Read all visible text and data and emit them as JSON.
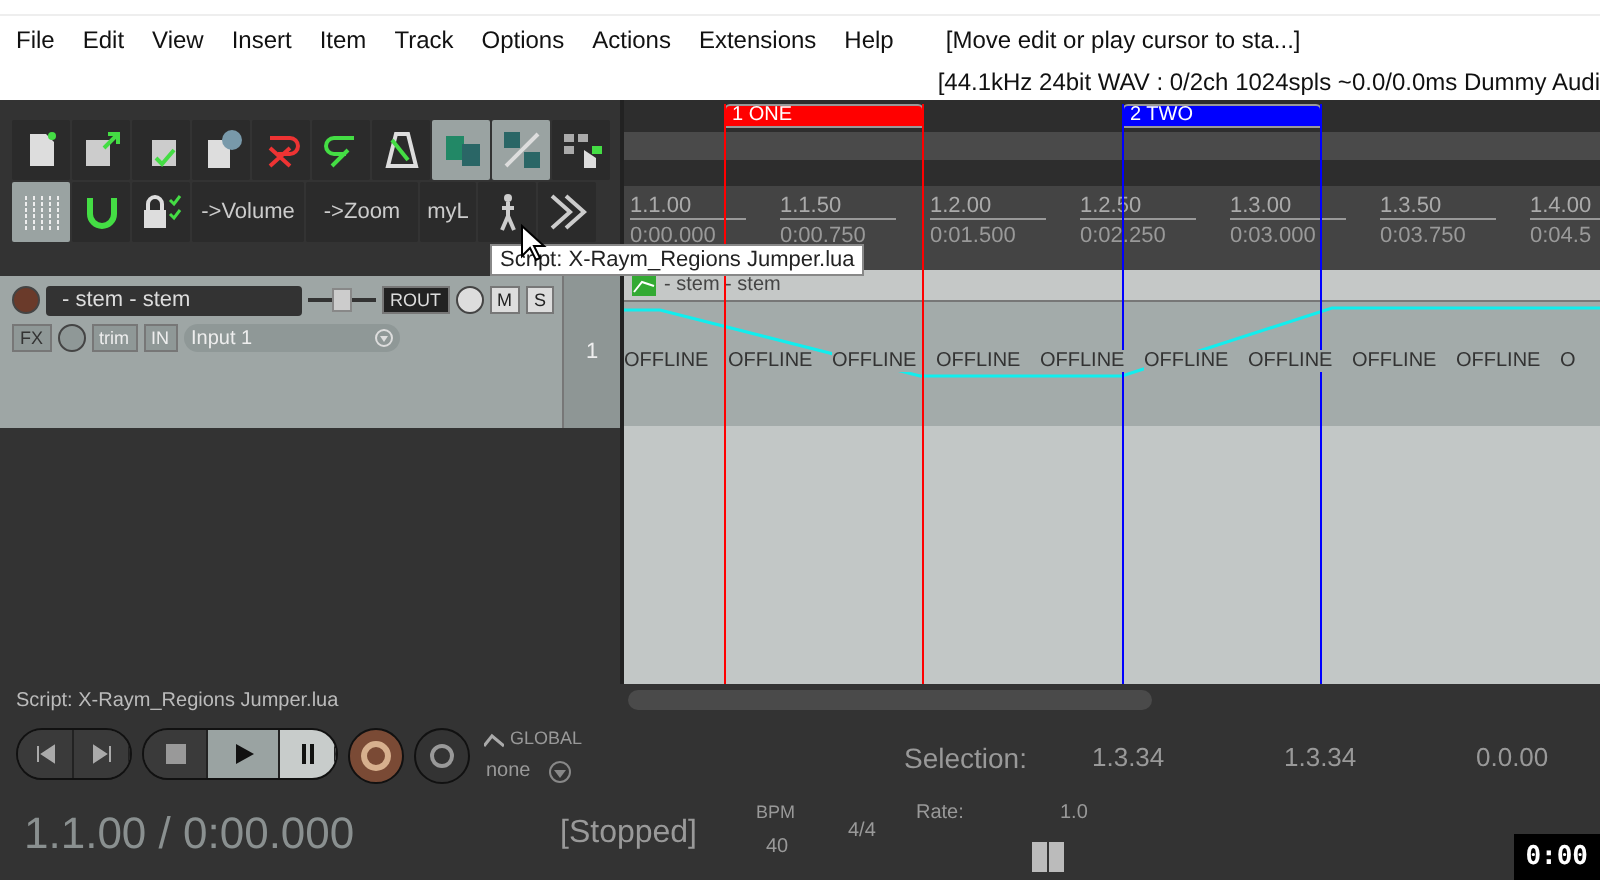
{
  "menu": {
    "items": [
      "File",
      "Edit",
      "View",
      "Insert",
      "Item",
      "Track",
      "Options",
      "Actions",
      "Extensions",
      "Help"
    ],
    "status": "[Move edit or play cursor to sta...]"
  },
  "audio_status": "[44.1kHz 24bit WAV : 0/2ch 1024spls ~0.0/0.0ms Dummy Audi",
  "toolbar": {
    "row_1": [
      {
        "kind": "new",
        "selected": false
      },
      {
        "kind": "open",
        "selected": false
      },
      {
        "kind": "save",
        "selected": false
      },
      {
        "kind": "info",
        "selected": false
      },
      {
        "kind": "undo",
        "selected": false
      },
      {
        "kind": "redo",
        "selected": false
      },
      {
        "kind": "metronome",
        "selected": false
      },
      {
        "kind": "snap",
        "selected": true
      },
      {
        "kind": "unlink",
        "selected": true
      },
      {
        "kind": "grid-hand",
        "selected": false
      }
    ],
    "row_2": [
      {
        "kind": "grid",
        "selected": true
      },
      {
        "kind": "magnet",
        "selected": false
      },
      {
        "kind": "lock",
        "selected": false
      },
      {
        "kind": "text",
        "label": "->Volume",
        "selected": false
      },
      {
        "kind": "text",
        "label": "->Zoom",
        "selected": false
      },
      {
        "kind": "text",
        "label": "myL",
        "selected": false
      },
      {
        "kind": "walker",
        "selected": false
      },
      {
        "kind": "forward",
        "selected": false
      }
    ]
  },
  "tooltip": "Script: X-Raym_Regions Jumper.lua",
  "track": {
    "name": "- stem - stem",
    "route": "ROUT",
    "mute": "M",
    "solo": "S",
    "fx": "FX",
    "trim": "trim",
    "input_mode": "IN",
    "input": "Input 1",
    "number": "1"
  },
  "regions": [
    {
      "label": "1  ONE",
      "color": "#ff0000"
    },
    {
      "label": "2  TWO",
      "color": "#0000ff"
    }
  ],
  "ruler": [
    {
      "beat": "1.1.00",
      "time": "0:00.000"
    },
    {
      "beat": "1.1.50",
      "time": "0:00.750"
    },
    {
      "beat": "1.2.00",
      "time": "0:01.500"
    },
    {
      "beat": "1.2.50",
      "time": "0:02.250"
    },
    {
      "beat": "1.3.00",
      "time": "0:03.000"
    },
    {
      "beat": "1.3.50",
      "time": "0:03.750"
    },
    {
      "beat": "1.4.00",
      "time": "0:04.5"
    }
  ],
  "item": {
    "take": "- stem - stem",
    "labels": [
      "OFFLINE",
      "OFFLINE",
      "OFFLINE",
      "OFFLINE",
      "OFFLINE",
      "OFFLINE",
      "OFFLINE",
      "OFFLINE",
      "OFFLINE",
      "O"
    ]
  },
  "status_line": "Script: X-Raym_Regions Jumper.lua",
  "transport": {
    "automation": "GLOBAL",
    "automation_mode": "none",
    "position": "1.1.00 / 0:00.000",
    "state": "[Stopped]",
    "bpm_label": "BPM",
    "bpm": "40",
    "signature": "4/4",
    "rate_label": "Rate:",
    "rate": "1.0",
    "selection_label": "Selection:",
    "selection": [
      "1.3.34",
      "1.3.34",
      "0.0.00"
    ]
  },
  "recording_timer": "0:00"
}
